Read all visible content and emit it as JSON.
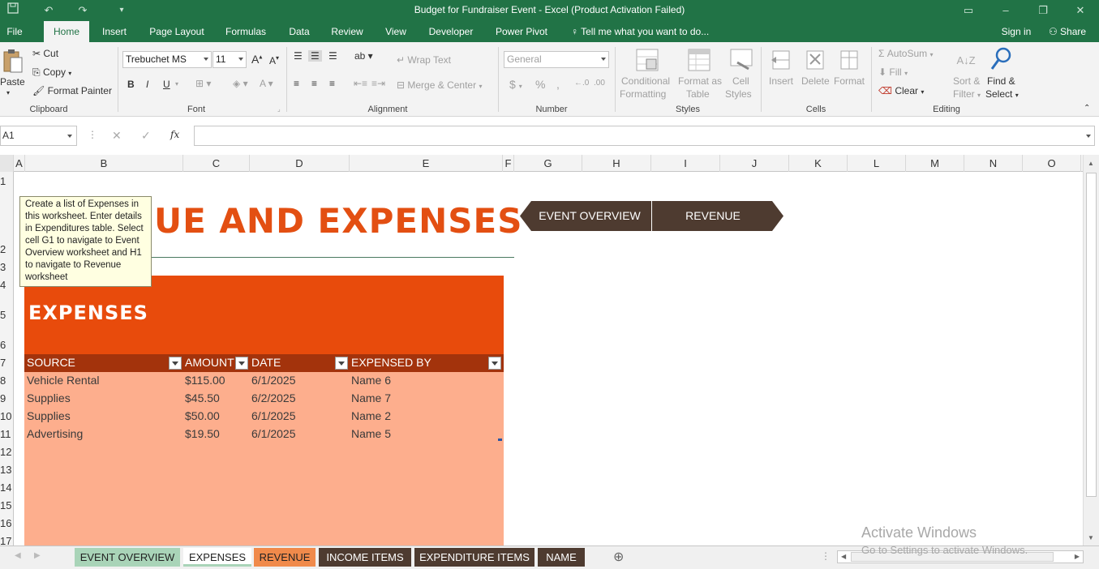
{
  "window": {
    "title": "Budget for Fundraiser Event - Excel (Product Activation Failed)"
  },
  "menu": {
    "tabs": [
      "File",
      "Home",
      "Insert",
      "Page Layout",
      "Formulas",
      "Data",
      "Review",
      "View",
      "Developer",
      "Power Pivot"
    ],
    "active": "Home",
    "tell_me": "Tell me what you want to do...",
    "sign_in": "Sign in",
    "share": "Share"
  },
  "ribbon": {
    "clipboard": {
      "paste": "Paste",
      "cut": "Cut",
      "copy": "Copy",
      "format_painter": "Format Painter",
      "label": "Clipboard"
    },
    "font": {
      "name": "Trebuchet MS",
      "size": "11",
      "bold": "B",
      "italic": "I",
      "underline": "U",
      "label": "Font"
    },
    "alignment": {
      "wrap_text": "Wrap Text",
      "merge_center": "Merge & Center",
      "label": "Alignment"
    },
    "number": {
      "format": "General",
      "currency": "$",
      "percent": "%",
      "comma": ",",
      "label": "Number"
    },
    "styles": {
      "conditional": "Conditional",
      "conditional2": "Formatting",
      "format_as": "Format as",
      "table": "Table",
      "cell": "Cell",
      "cell_styles": "Styles",
      "label": "Styles"
    },
    "cells": {
      "insert": "Insert",
      "delete": "Delete",
      "format": "Format",
      "label": "Cells"
    },
    "editing": {
      "autosum": "AutoSum",
      "fill": "Fill",
      "clear": "Clear",
      "sort": "Sort &",
      "filter": "Filter",
      "find": "Find &",
      "select": "Select",
      "label": "Editing"
    }
  },
  "formula_bar": {
    "name_box": "A1",
    "fx": "fx",
    "value": ""
  },
  "columns": [
    "A",
    "B",
    "C",
    "D",
    "E",
    "F",
    "G",
    "H",
    "I",
    "J",
    "K",
    "L",
    "M",
    "N",
    "O"
  ],
  "rows": [
    "1",
    "2",
    "3",
    "4",
    "5",
    "6",
    "7",
    "8",
    "9",
    "10",
    "11",
    "12",
    "13",
    "14",
    "15",
    "16",
    "17"
  ],
  "sheet": {
    "title_visible": "UE AND EXPENSES",
    "section_title": "EXPENSES",
    "nav_overview": "EVENT OVERVIEW",
    "nav_revenue": "REVENUE",
    "table_headers": [
      "SOURCE",
      "AMOUNT",
      "DATE",
      "EXPENSED BY"
    ],
    "table_rows": [
      [
        "Vehicle Rental",
        "$115.00",
        "6/1/2025",
        "Name 6"
      ],
      [
        "Supplies",
        "$45.50",
        "6/2/2025",
        "Name 7"
      ],
      [
        "Supplies",
        "$50.00",
        "6/1/2025",
        "Name 2"
      ],
      [
        "Advertising",
        "$19.50",
        "6/1/2025",
        "Name 5"
      ]
    ]
  },
  "tooltip": "Create a list of Expenses in this worksheet. Enter details in Expenditures table. Select cell G1 to navigate to Event Overview worksheet and H1 to navigate to Revenue worksheet",
  "sheet_tabs": [
    "EVENT OVERVIEW",
    "EXPENSES",
    "REVENUE",
    "INCOME ITEMS",
    "EXPENDITURE ITEMS",
    "NAME"
  ],
  "active_sheet": "EXPENSES",
  "watermark": {
    "line1": "Activate Windows",
    "line2": "Go to Settings to activate Windows."
  },
  "colors": {
    "excel_green": "#217346",
    "title_orange": "#e34f12",
    "block_orange": "#e84b0c",
    "header_brown": "#a3330c",
    "table_peach": "#fdae8d",
    "nav_brown": "#4e3b30"
  }
}
